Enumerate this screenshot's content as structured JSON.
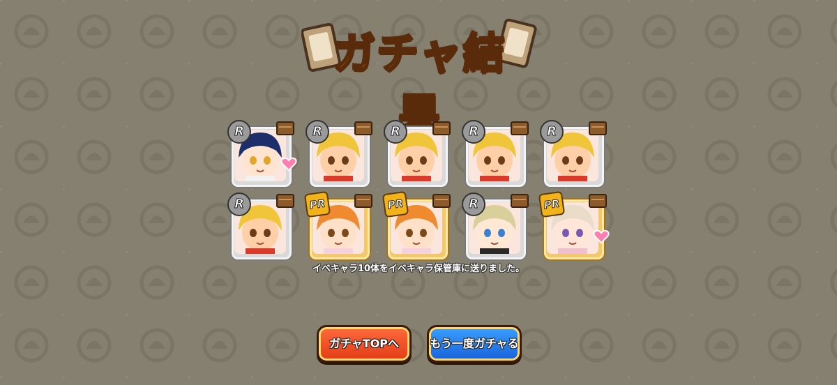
{
  "title": "ガチャ結果",
  "colors": {
    "background": "#85806f",
    "title": "#f99a17",
    "r_badge": "#9a9a9a",
    "pr_badge": "#f2b21a",
    "button_orange": "#e23c15",
    "button_blue": "#1761d9"
  },
  "results": [
    {
      "rarity": "R",
      "character": "blue-hair-girl",
      "heart": true
    },
    {
      "rarity": "R",
      "character": "blonde-girl",
      "heart": false
    },
    {
      "rarity": "R",
      "character": "blonde-girl",
      "heart": false
    },
    {
      "rarity": "R",
      "character": "blonde-girl",
      "heart": false
    },
    {
      "rarity": "R",
      "character": "blonde-girl",
      "heart": false
    },
    {
      "rarity": "R",
      "character": "blonde-girl",
      "heart": false
    },
    {
      "rarity": "PR",
      "character": "orange-hair-girl",
      "heart": false
    },
    {
      "rarity": "PR",
      "character": "orange-hair-girl",
      "heart": false
    },
    {
      "rarity": "R",
      "character": "blonde-boy",
      "heart": false
    },
    {
      "rarity": "PR",
      "character": "silver-hair-man",
      "heart": true
    }
  ],
  "message": "イベキャラ10体をイベキャラ保管庫に送りました。",
  "buttons": {
    "gacha_top": "ガチャTOPへ",
    "retry": "もう一度ガチャる"
  }
}
